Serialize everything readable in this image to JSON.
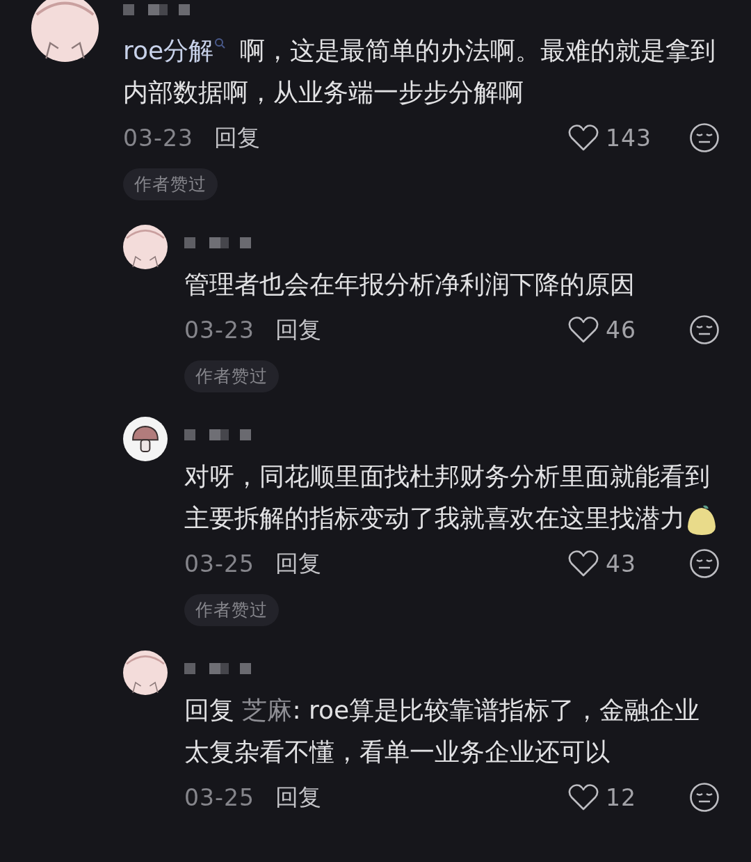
{
  "comments": [
    {
      "avatar": {
        "kind": "blob"
      },
      "text": [
        {
          "kind": "search-link",
          "text": "roe分解"
        },
        {
          "kind": "plain",
          "text": " 啊，这是最简单的办法啊。最难的就是拿到内部数据啊，从业务端一步步分解啊"
        }
      ],
      "date": "03-23",
      "reply_label": "回复",
      "likes": "143",
      "author_liked": true,
      "badge": "作者赞过",
      "replies": [
        {
          "avatar": {
            "kind": "blob"
          },
          "text": [
            {
              "kind": "plain",
              "text": "管理者也会在年报分析净利润下降的原因"
            }
          ],
          "date": "03-23",
          "reply_label": "回复",
          "likes": "46",
          "author_liked": true,
          "badge": "作者赞过"
        },
        {
          "avatar": {
            "kind": "mushroom"
          },
          "text": [
            {
              "kind": "plain",
              "text": "对呀，同花顺里面找杜邦财务分析里面就能看到主要拆解的指标变动了我就喜欢在这里找潜力"
            },
            {
              "kind": "sticker"
            }
          ],
          "date": "03-25",
          "reply_label": "回复",
          "likes": "43",
          "author_liked": true,
          "badge": "作者赞过"
        },
        {
          "avatar": {
            "kind": "blob"
          },
          "text": [
            {
              "kind": "plain",
              "text": "回复 "
            },
            {
              "kind": "mention",
              "text": "芝麻"
            },
            {
              "kind": "plain",
              "text": ": roe算是比较靠谱指标了，金融企业太复杂看不懂，看单一业务企业还可以"
            }
          ],
          "date": "03-25",
          "reply_label": "回复",
          "likes": "12",
          "author_liked": false
        }
      ]
    }
  ]
}
